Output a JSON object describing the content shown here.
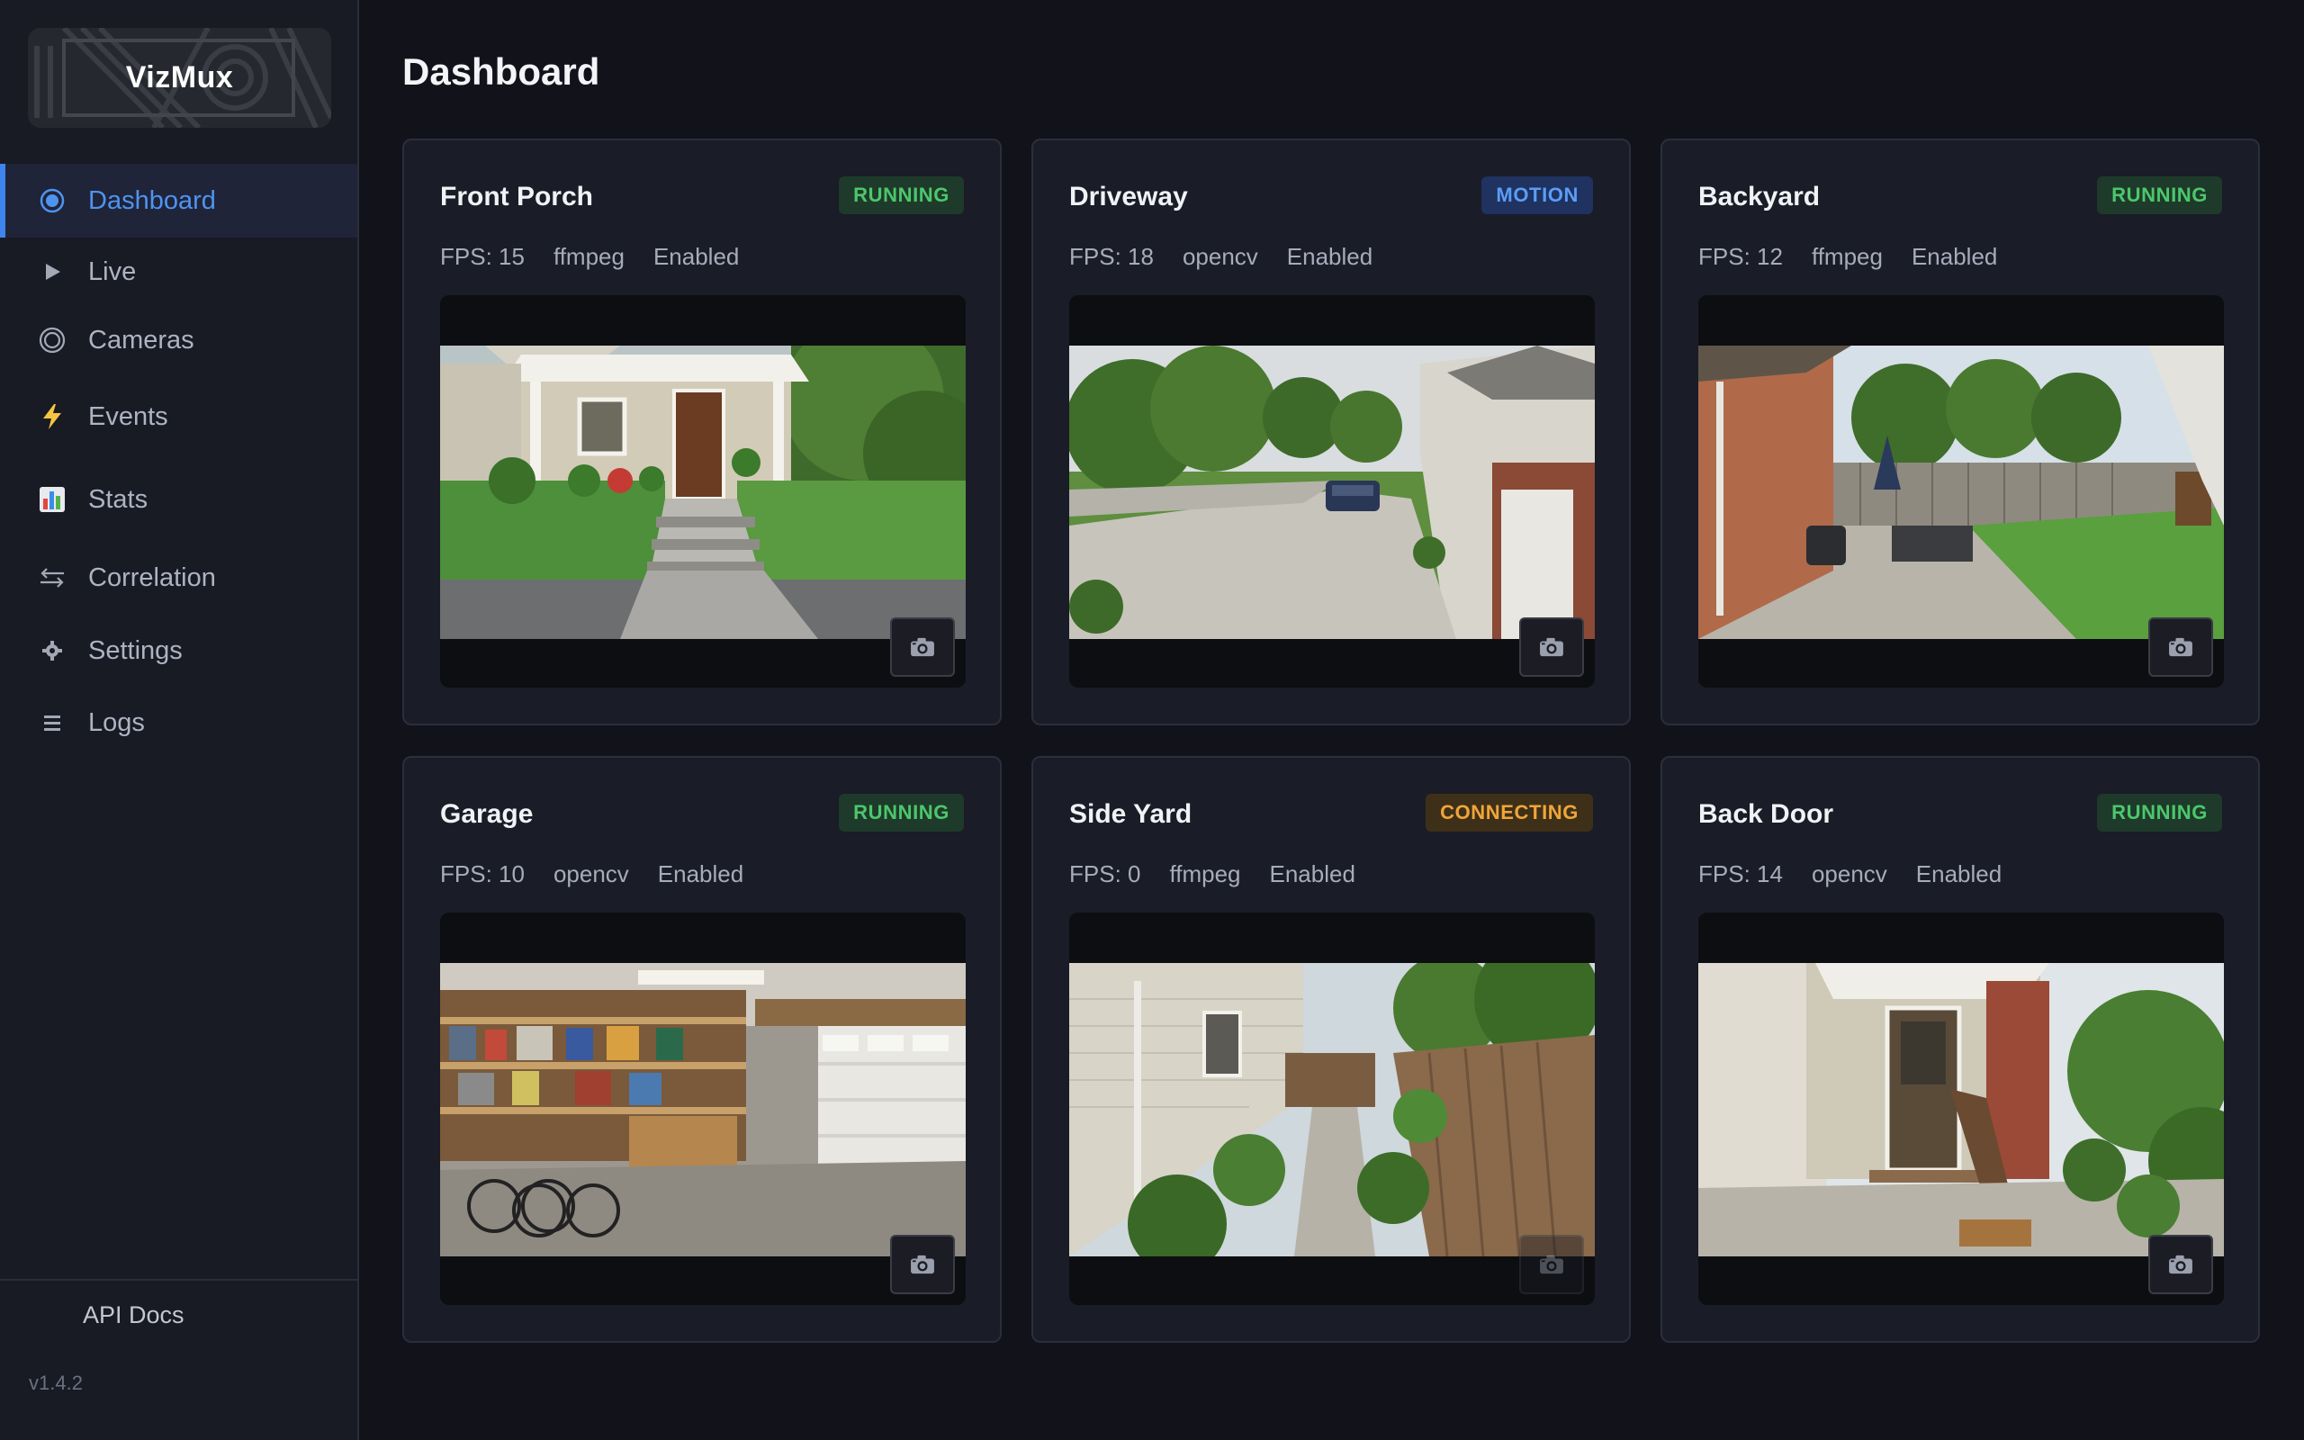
{
  "app": {
    "name": "VizMux",
    "version": "v1.4.2"
  },
  "sidebar": {
    "items": [
      {
        "label": "Dashboard",
        "icon": "dashboard-icon"
      },
      {
        "label": "Live",
        "icon": "play-icon"
      },
      {
        "label": "Cameras",
        "icon": "camera-icon"
      },
      {
        "label": "Events",
        "icon": "lightning-icon"
      },
      {
        "label": "Stats",
        "icon": "bar-chart-icon"
      },
      {
        "label": "Correlation",
        "icon": "arrows-icon"
      },
      {
        "label": "Settings",
        "icon": "gear-icon"
      },
      {
        "label": "Logs",
        "icon": "list-icon"
      }
    ],
    "api_docs": "API Docs"
  },
  "main": {
    "title": "Dashboard",
    "cameras": [
      {
        "name": "Front Porch",
        "status": "RUNNING",
        "fps": "FPS: 15",
        "backend": "ffmpeg",
        "state": "Enabled",
        "scene": "front-porch"
      },
      {
        "name": "Driveway",
        "status": "MOTION",
        "fps": "FPS: 18",
        "backend": "opencv",
        "state": "Enabled",
        "scene": "driveway"
      },
      {
        "name": "Backyard",
        "status": "RUNNING",
        "fps": "FPS: 12",
        "backend": "ffmpeg",
        "state": "Enabled",
        "scene": "backyard"
      },
      {
        "name": "Garage",
        "status": "RUNNING",
        "fps": "FPS: 10",
        "backend": "opencv",
        "state": "Enabled",
        "scene": "garage"
      },
      {
        "name": "Side Yard",
        "status": "CONNECTING",
        "fps": "FPS: 0",
        "backend": "ffmpeg",
        "state": "Enabled",
        "scene": "side-yard"
      },
      {
        "name": "Back Door",
        "status": "RUNNING",
        "fps": "FPS: 14",
        "backend": "opencv",
        "state": "Enabled",
        "scene": "back-door"
      }
    ]
  },
  "colors": {
    "accent": "#3f84ee",
    "running": "#4cc76b",
    "motion": "#5b9df7",
    "connecting": "#f0a53a"
  }
}
